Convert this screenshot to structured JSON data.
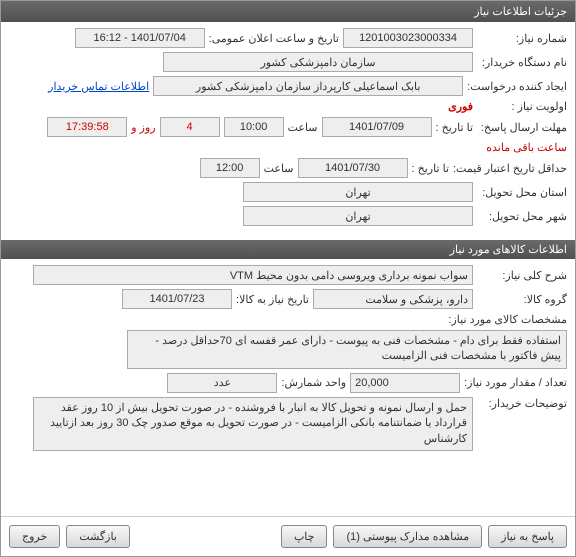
{
  "window": {
    "title": "جزئیات اطلاعات نیاز"
  },
  "need": {
    "labels": {
      "number": "شماره نیاز:",
      "publish": "تاریخ و ساعت اعلان عمومی:",
      "buyer": "نام دستگاه خریدار:",
      "requester": "ایجاد کننده درخواست:",
      "contact": "اطلاعات تماس خریدار",
      "priority": "اولویت نیاز :",
      "deadline": "مهلت ارسال پاسخ:",
      "to_date": "تا تاریخ :",
      "time": "ساعت",
      "days_and": "روز و",
      "remaining": "ساعت باقی مانده",
      "min_valid": "حداقل تاریخ اعتبار قیمت:",
      "deliver_prov": "استان محل تحویل:",
      "deliver_city": "شهر محل تحویل:"
    },
    "number": "1201003023000334",
    "publish_datetime": "1401/07/04 - 16:12",
    "buyer": "سازمان دامپزشکی کشور",
    "requester": "بابک اسماعیلی کارپرداز سازمان دامپزشکی کشور",
    "priority": "فوری",
    "deadline_date": "1401/07/09",
    "deadline_time": "10:00",
    "days_left": "4",
    "time_left": "17:39:58",
    "min_valid_date": "1401/07/30",
    "min_valid_time": "12:00",
    "deliver_prov": "تهران",
    "deliver_city": "تهران"
  },
  "items_header": "اطلاعات کالاهای مورد نیاز",
  "item": {
    "labels": {
      "desc": "شرح کلی نیاز:",
      "group": "گروه کالا:",
      "need_date": "تاریخ نیاز به کالا:",
      "specs": "مشخصات کالای مورد نیاز:",
      "qty": "تعداد / مقدار مورد نیاز:",
      "unit": "واحد شمارش:",
      "buyer_notes": "توضیحات خریدار:"
    },
    "desc": "سواب نمونه برداری ویروسی  دامی بدون محیط VTM",
    "group": "دارو، پزشکی و سلامت",
    "need_date": "1401/07/23",
    "specs": "استفاده فقط برای دام  - مشخصات فنی به پیوست -  دارای عمر قفسه ای 70حداقل درصد  - پیش فاکتور با مشخصات فنی الزامیست",
    "qty": "20,000",
    "unit": "عدد",
    "buyer_notes": "حمل و ارسال نمونه  و تحویل کالا به انبار با فروشنده - در صورت تحویل بیش از 10 روز عقد قرارداد یا ضمانتنامه بانکی الزامیست - در صورت تحویل به موقع صدور چک 30 روز بعد ازتایید کارشناس"
  },
  "footer": {
    "reply": "پاسخ به نیاز",
    "attachments": "مشاهده مدارک پیوستی (1)",
    "print": "چاپ",
    "back": "بازگشت",
    "exit": "خروج"
  }
}
